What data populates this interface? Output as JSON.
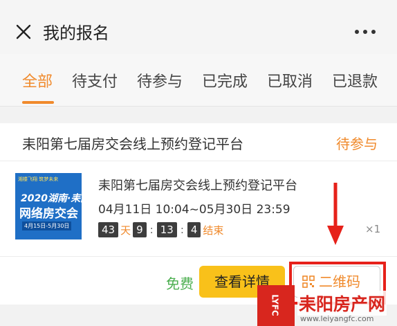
{
  "header": {
    "title": "我的报名",
    "close_icon": "close-icon",
    "more_icon": "more-icon"
  },
  "tabs": [
    {
      "label": "全部",
      "active": true
    },
    {
      "label": "待支付",
      "active": false
    },
    {
      "label": "待参与",
      "active": false
    },
    {
      "label": "已完成",
      "active": false
    },
    {
      "label": "已取消",
      "active": false
    },
    {
      "label": "已退款",
      "active": false
    }
  ],
  "order": {
    "title": "耒阳第七届房交会线上预约登记平台",
    "status": "待参与",
    "thumbnail": {
      "line1": "湘楼飞翔 筑梦未来",
      "line2": "2020湖南·耒阳",
      "line3": "网络房交会",
      "line4": "4月15日-5月30日"
    },
    "item_title": "耒阳第七届房交会线上预约登记平台",
    "date_range": "04月11日 10:04~05月30日 23:59",
    "countdown": {
      "days": "43",
      "day_unit": "天",
      "hours": "9",
      "minutes": "13",
      "seconds": "4",
      "end_label": "结束"
    },
    "quantity": "×1",
    "price": "免费",
    "detail_button": "查看详情",
    "qr_button": "二维码"
  },
  "watermark": {
    "name": "耒阳房产网",
    "url": "www.leiyangfc.com",
    "logo_text": "LYFC"
  },
  "colors": {
    "accent": "#f08a2c",
    "button_yellow": "#f9c11a",
    "free_green": "#4caf50",
    "highlight_red": "#e6211a"
  }
}
